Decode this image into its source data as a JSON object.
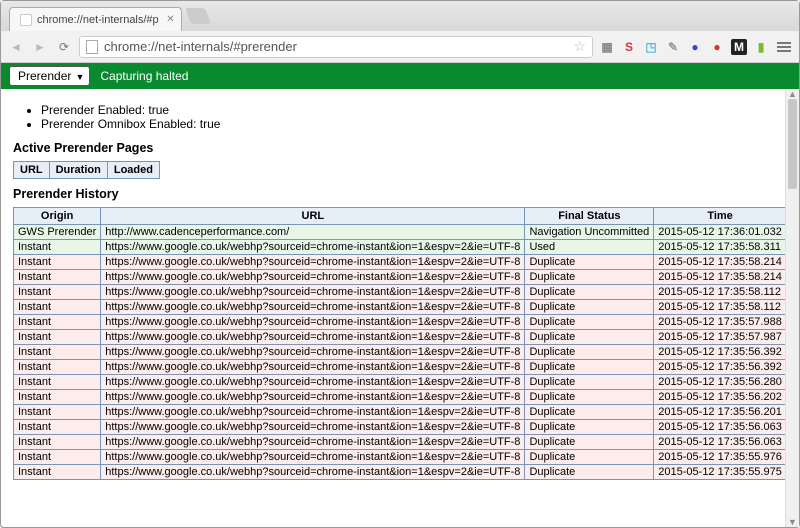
{
  "browser": {
    "tab_title": "chrome://net-internals/#p",
    "url": "chrome://net-internals/#prerender"
  },
  "greenbar": {
    "dropdown_label": "Prerender",
    "status_text": "Capturing halted"
  },
  "status_list": [
    "Prerender Enabled: true",
    "Prerender Omnibox Enabled: true"
  ],
  "headings": {
    "active": "Active Prerender Pages",
    "history": "Prerender History"
  },
  "active_table_headers": [
    "URL",
    "Duration",
    "Loaded"
  ],
  "history_headers": {
    "origin": "Origin",
    "url": "URL",
    "status": "Final Status",
    "time": "Time"
  },
  "history_rows": [
    {
      "origin": "GWS Prerender",
      "url": "http://www.cadenceperformance.com/",
      "status": "Navigation Uncommitted",
      "time": "2015-05-12 17:36:01.032",
      "class": "green"
    },
    {
      "origin": "Instant",
      "url": "https://www.google.co.uk/webhp?sourceid=chrome-instant&ion=1&espv=2&ie=UTF-8",
      "status": "Used",
      "time": "2015-05-12 17:35:58.311",
      "class": "green"
    },
    {
      "origin": "Instant",
      "url": "https://www.google.co.uk/webhp?sourceid=chrome-instant&ion=1&espv=2&ie=UTF-8",
      "status": "Duplicate",
      "time": "2015-05-12 17:35:58.214",
      "class": "pink"
    },
    {
      "origin": "Instant",
      "url": "https://www.google.co.uk/webhp?sourceid=chrome-instant&ion=1&espv=2&ie=UTF-8",
      "status": "Duplicate",
      "time": "2015-05-12 17:35:58.214",
      "class": "pink"
    },
    {
      "origin": "Instant",
      "url": "https://www.google.co.uk/webhp?sourceid=chrome-instant&ion=1&espv=2&ie=UTF-8",
      "status": "Duplicate",
      "time": "2015-05-12 17:35:58.112",
      "class": "pink"
    },
    {
      "origin": "Instant",
      "url": "https://www.google.co.uk/webhp?sourceid=chrome-instant&ion=1&espv=2&ie=UTF-8",
      "status": "Duplicate",
      "time": "2015-05-12 17:35:58.112",
      "class": "pink"
    },
    {
      "origin": "Instant",
      "url": "https://www.google.co.uk/webhp?sourceid=chrome-instant&ion=1&espv=2&ie=UTF-8",
      "status": "Duplicate",
      "time": "2015-05-12 17:35:57.988",
      "class": "pink"
    },
    {
      "origin": "Instant",
      "url": "https://www.google.co.uk/webhp?sourceid=chrome-instant&ion=1&espv=2&ie=UTF-8",
      "status": "Duplicate",
      "time": "2015-05-12 17:35:57.987",
      "class": "pink"
    },
    {
      "origin": "Instant",
      "url": "https://www.google.co.uk/webhp?sourceid=chrome-instant&ion=1&espv=2&ie=UTF-8",
      "status": "Duplicate",
      "time": "2015-05-12 17:35:56.392",
      "class": "pink"
    },
    {
      "origin": "Instant",
      "url": "https://www.google.co.uk/webhp?sourceid=chrome-instant&ion=1&espv=2&ie=UTF-8",
      "status": "Duplicate",
      "time": "2015-05-12 17:35:56.392",
      "class": "pink"
    },
    {
      "origin": "Instant",
      "url": "https://www.google.co.uk/webhp?sourceid=chrome-instant&ion=1&espv=2&ie=UTF-8",
      "status": "Duplicate",
      "time": "2015-05-12 17:35:56.280",
      "class": "pink"
    },
    {
      "origin": "Instant",
      "url": "https://www.google.co.uk/webhp?sourceid=chrome-instant&ion=1&espv=2&ie=UTF-8",
      "status": "Duplicate",
      "time": "2015-05-12 17:35:56.202",
      "class": "pink"
    },
    {
      "origin": "Instant",
      "url": "https://www.google.co.uk/webhp?sourceid=chrome-instant&ion=1&espv=2&ie=UTF-8",
      "status": "Duplicate",
      "time": "2015-05-12 17:35:56.201",
      "class": "pink"
    },
    {
      "origin": "Instant",
      "url": "https://www.google.co.uk/webhp?sourceid=chrome-instant&ion=1&espv=2&ie=UTF-8",
      "status": "Duplicate",
      "time": "2015-05-12 17:35:56.063",
      "class": "pink"
    },
    {
      "origin": "Instant",
      "url": "https://www.google.co.uk/webhp?sourceid=chrome-instant&ion=1&espv=2&ie=UTF-8",
      "status": "Duplicate",
      "time": "2015-05-12 17:35:56.063",
      "class": "pink"
    },
    {
      "origin": "Instant",
      "url": "https://www.google.co.uk/webhp?sourceid=chrome-instant&ion=1&espv=2&ie=UTF-8",
      "status": "Duplicate",
      "time": "2015-05-12 17:35:55.976",
      "class": "pink"
    },
    {
      "origin": "Instant",
      "url": "https://www.google.co.uk/webhp?sourceid=chrome-instant&ion=1&espv=2&ie=UTF-8",
      "status": "Duplicate",
      "time": "2015-05-12 17:35:55.975",
      "class": "pink"
    }
  ],
  "ext_icons": [
    {
      "label": "▦",
      "color": "#888"
    },
    {
      "label": "S",
      "color": "#d33"
    },
    {
      "label": "◳",
      "color": "#5bd"
    },
    {
      "label": "✎",
      "color": "#8a8"
    },
    {
      "label": "●",
      "color": "#34d"
    },
    {
      "label": "●",
      "color": "#c33"
    },
    {
      "label": "M",
      "color": "#fff",
      "bg": "#222"
    },
    {
      "label": "▮",
      "color": "#7b3"
    }
  ]
}
